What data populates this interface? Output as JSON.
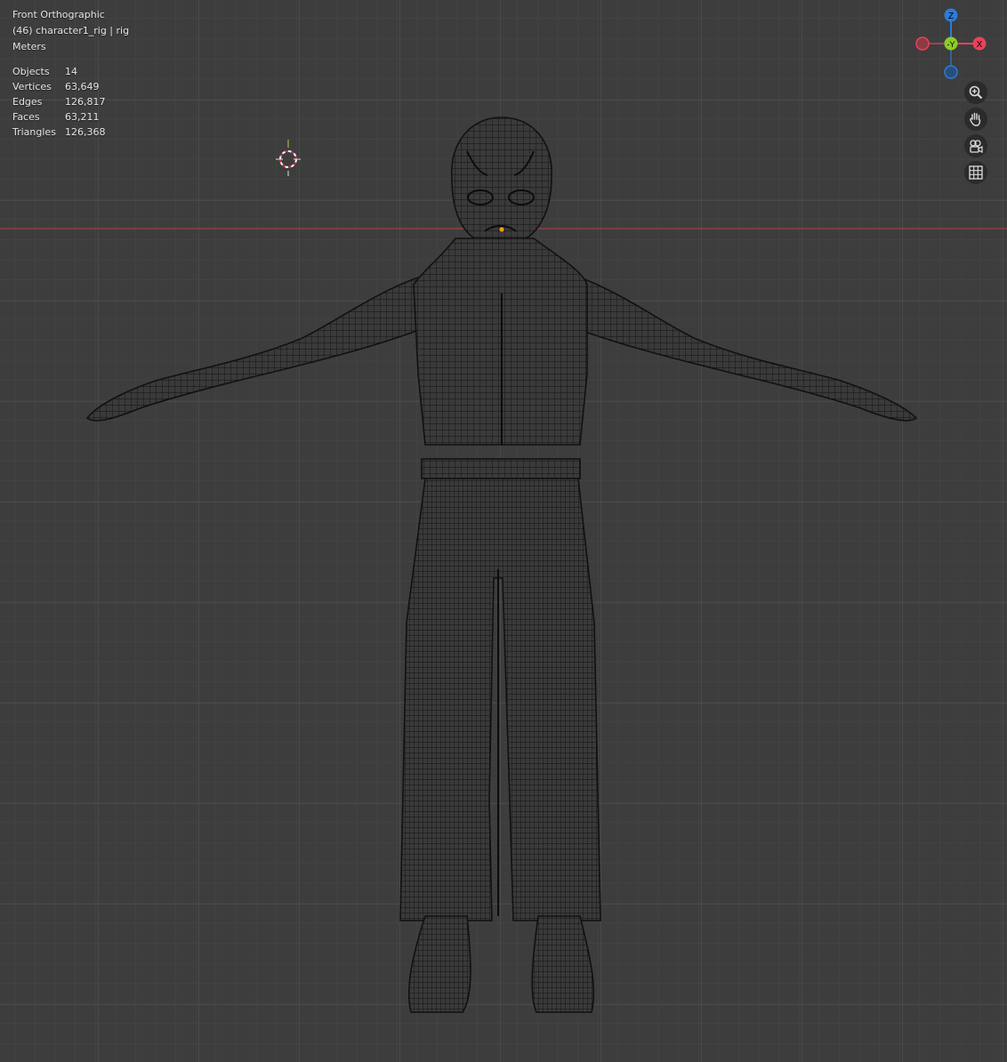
{
  "viewport": {
    "view_name": "Front Orthographic",
    "object_info": "(46) character1_rig | rig",
    "units": "Meters",
    "stats": [
      {
        "label": "Objects",
        "value": "14"
      },
      {
        "label": "Vertices",
        "value": "63,649"
      },
      {
        "label": "Edges",
        "value": "126,817"
      },
      {
        "label": "Faces",
        "value": "63,211"
      },
      {
        "label": "Triangles",
        "value": "126,368"
      }
    ]
  },
  "gizmo": {
    "z_label": "Z",
    "y_label": "-Y",
    "x_label": "X",
    "colors": {
      "x": "#e8425a",
      "y": "#8ccc26",
      "z": "#2e7bd6"
    }
  },
  "nav_buttons": [
    {
      "name": "zoom-icon"
    },
    {
      "name": "hand-pan-icon"
    },
    {
      "name": "camera-view-icon"
    },
    {
      "name": "grid-perspective-icon"
    }
  ],
  "colors": {
    "background": "#3d3d3d",
    "grid_minor": "#474747",
    "grid_major": "#565656",
    "x_axis": "#b34145",
    "wire": "#101010"
  }
}
